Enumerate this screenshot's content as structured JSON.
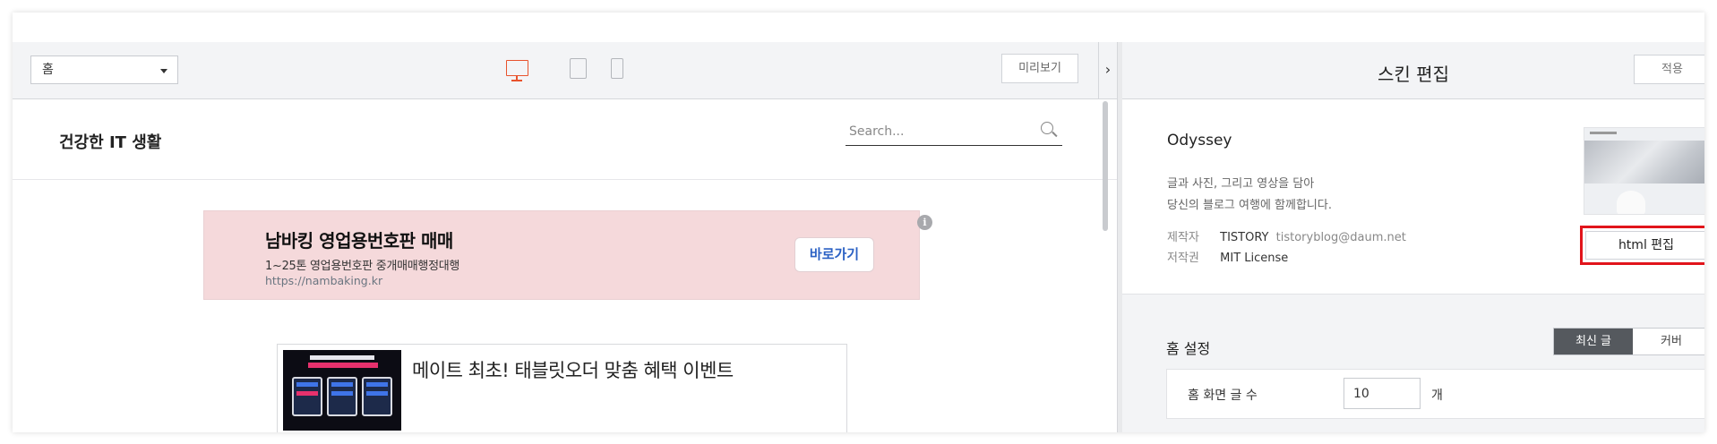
{
  "toolbar": {
    "page_select_value": "홈",
    "preview_label": "미리보기",
    "toggle_glyph": "›"
  },
  "blog": {
    "title": "건강한 IT 생활",
    "search_placeholder": "Search..."
  },
  "ad": {
    "title": "남바킹 영업용번호판 매매",
    "description": "1~25톤 영업용번호판 중개매매행정대행",
    "url": "https://nambaking.kr",
    "cta_label": "바로가기",
    "info_glyph": "i"
  },
  "promo": {
    "title": "메이트 최초! 태블릿오더 맞춤 혜택 이벤트"
  },
  "editor": {
    "title": "스킨 편집",
    "apply_label": "적용",
    "skin": {
      "name": "Odyssey",
      "description_line1": "글과 사진, 그리고 영상을 담아",
      "description_line2": "당신의 블로그 여행에 함께합니다.",
      "author_label": "제작자",
      "author_value": "TISTORY",
      "author_email": "tistoryblog@daum.net",
      "license_label": "저작권",
      "license_value": "MIT License",
      "html_edit_label": "html 편집"
    },
    "home_settings": {
      "label": "홈 설정",
      "tabs": [
        "최신 글",
        "커버"
      ],
      "active_tab": 0,
      "post_count_label": "홈 화면 글 수",
      "post_count_value": "10",
      "post_count_unit": "개"
    }
  },
  "colors": {
    "accent_device": "#e8532d",
    "ad_background": "#f5d9db",
    "ad_cta_text": "#2b61c4",
    "highlight_border": "#e1141b",
    "tab_active_bg": "#55595e"
  },
  "icons": [
    "chevron-down-icon",
    "desktop-icon",
    "tablet-icon",
    "mobile-icon",
    "chevron-right-icon",
    "search-icon",
    "info-icon"
  ]
}
